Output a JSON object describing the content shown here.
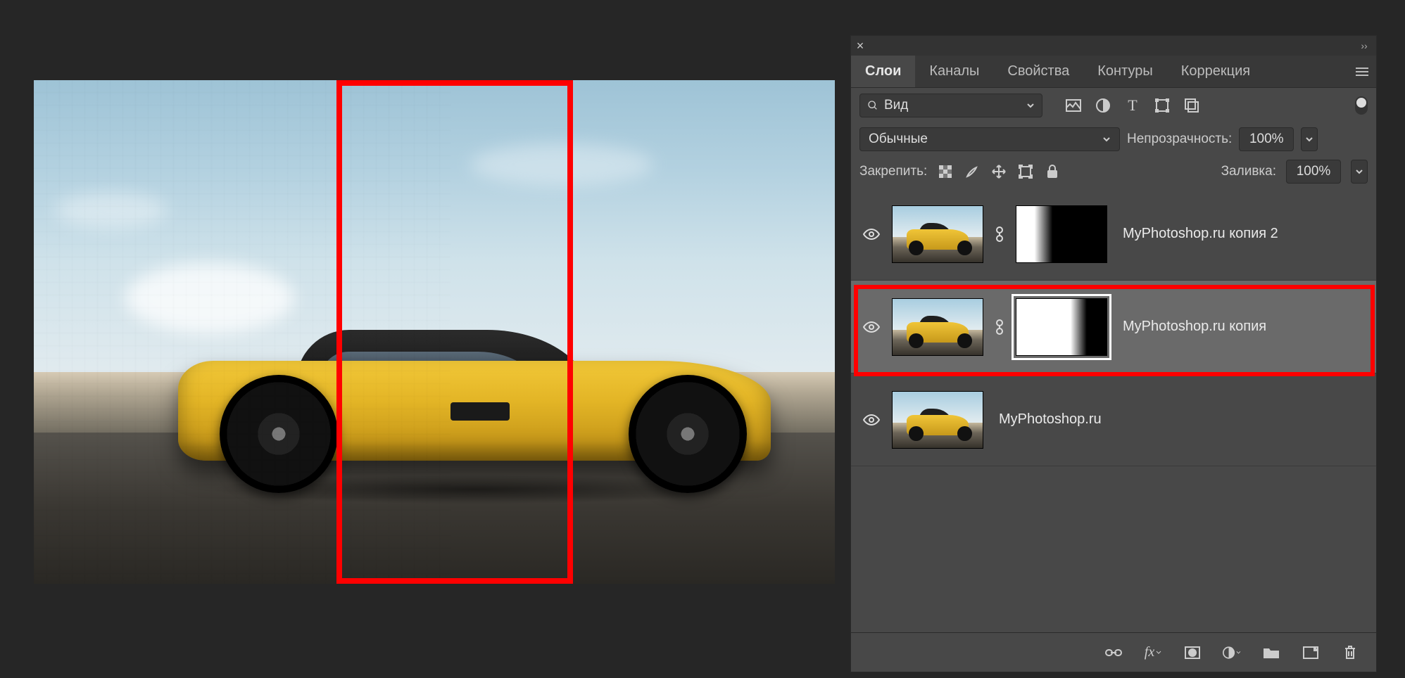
{
  "panel": {
    "tabs": [
      "Слои",
      "Каналы",
      "Свойства",
      "Контуры",
      "Коррекция"
    ],
    "active_tab": 0,
    "search_kind": "Вид",
    "blend_mode": "Обычные",
    "opacity_label": "Непрозрачность:",
    "opacity_value": "100%",
    "lock_label": "Закрепить:",
    "fill_label": "Заливка:",
    "fill_value": "100%"
  },
  "layers": [
    {
      "name": "MyPhotoshop.ru копия 2",
      "visible": true,
      "has_mask": true,
      "mask_style": "a",
      "selected": false
    },
    {
      "name": "MyPhotoshop.ru копия",
      "visible": true,
      "has_mask": true,
      "mask_style": "b",
      "selected": true
    },
    {
      "name": "MyPhotoshop.ru",
      "visible": true,
      "has_mask": false,
      "selected": false
    }
  ]
}
